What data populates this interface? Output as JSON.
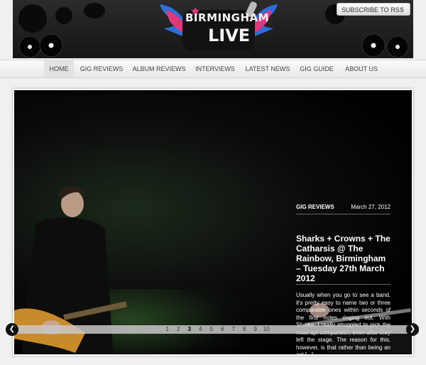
{
  "header": {
    "rss_label": "SUBSCRIBE TO RSS",
    "logo_line1": "BIRMINGHAM",
    "logo_line2": "LIVE"
  },
  "nav": {
    "items": [
      {
        "label": "HOME"
      },
      {
        "label": "GIG REVIEWS"
      },
      {
        "label": "ALBUM REVIEWS"
      },
      {
        "label": "INTERVIEWS"
      },
      {
        "label": "LATEST NEWS"
      },
      {
        "label": "GIG GUIDE"
      },
      {
        "label": "ABOUT US"
      }
    ],
    "active": "HOME"
  },
  "slide": {
    "category": "GIG REVIEWS",
    "date": "March 27, 2012",
    "title": "Sharks + Crowns + The Catharsis @ The Rainbow, Birmingham – Tuesday 27th March 2012",
    "excerpt": "Usually when you go to see a band, it's pretty easy to name two or three comparable ones within seconds of the first notes ringing out. With Sharks, I really struggled to pick the most apt comparison, even after they left the stage. The reason for this, however, is that rather than being an act [...]"
  },
  "pager": {
    "pages": [
      "1",
      "2",
      "3",
      "4",
      "5",
      "6",
      "7",
      "8",
      "9",
      "10"
    ],
    "current": "3"
  },
  "icons": {
    "rss": "rss-icon",
    "prev": "chevron-left-icon",
    "next": "chevron-right-icon"
  },
  "colors": {
    "logo_pink": "#e0387a",
    "logo_blue": "#2d6fd6"
  }
}
